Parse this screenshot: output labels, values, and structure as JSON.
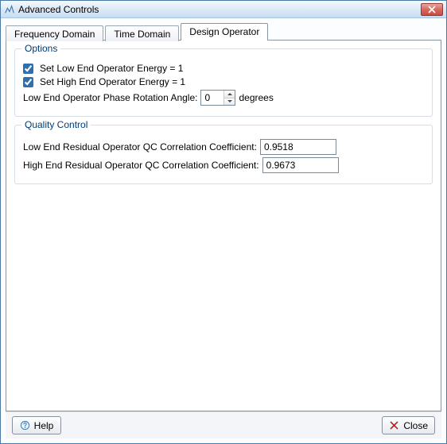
{
  "window": {
    "title": "Advanced Controls"
  },
  "tabs": {
    "items": [
      {
        "label": "Frequency Domain"
      },
      {
        "label": "Time Domain"
      },
      {
        "label": "Design Operator"
      }
    ],
    "active_index": 2
  },
  "options_group": {
    "legend": "Options",
    "set_low_label": "Set Low End Operator Energy = 1",
    "set_low_checked": true,
    "set_high_label": "Set High End Operator Energy = 1",
    "set_high_checked": true,
    "phase_label": "Low End Operator Phase Rotation Angle:",
    "phase_value": "0",
    "phase_units": "degrees"
  },
  "qc_group": {
    "legend": "Quality Control",
    "low_label": "Low End Residual Operator QC Correlation Coefficient:",
    "low_value": "0.9518",
    "high_label": "High End Residual Operator QC Correlation Coefficient:",
    "high_value": "0.9673"
  },
  "footer": {
    "help_label": "Help",
    "close_label": "Close"
  }
}
